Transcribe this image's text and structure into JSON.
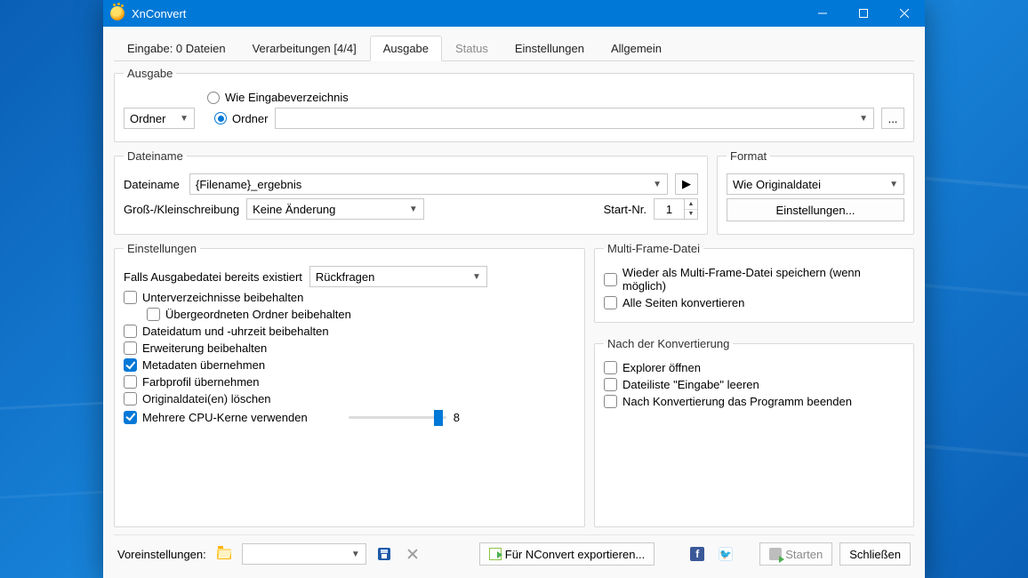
{
  "window": {
    "title": "XnConvert"
  },
  "tabs": [
    {
      "label": "Eingabe: 0 Dateien"
    },
    {
      "label": "Verarbeitungen [4/4]"
    },
    {
      "label": "Ausgabe",
      "active": true
    },
    {
      "label": "Status",
      "dim": true
    },
    {
      "label": "Einstellungen"
    },
    {
      "label": "Allgemein"
    }
  ],
  "output": {
    "legend": "Ausgabe",
    "target_select": "Ordner",
    "radio_same_as_input": "Wie Eingabeverzeichnis",
    "radio_folder": "Ordner",
    "folder_path": "",
    "browse": "..."
  },
  "filename": {
    "legend": "Dateiname",
    "label": "Dateiname",
    "value": "{Filename}_ergebnis",
    "play": "▶",
    "case_label": "Groß-/Kleinschreibung",
    "case_value": "Keine Änderung",
    "start_label": "Start-Nr.",
    "start_value": "1"
  },
  "format": {
    "legend": "Format",
    "value": "Wie Originaldatei",
    "settings_btn": "Einstellungen..."
  },
  "settings": {
    "legend": "Einstellungen",
    "exists_label": "Falls Ausgabedatei bereits existiert",
    "exists_value": "Rückfragen",
    "keep_subdirs": "Unterverzeichnisse beibehalten",
    "keep_parent": "Übergeordneten Ordner beibehalten",
    "keep_date": "Dateidatum und -uhrzeit beibehalten",
    "keep_ext": "Erweiterung beibehalten",
    "keep_meta": "Metadaten übernehmen",
    "keep_color": "Farbprofil übernehmen",
    "delete_orig": "Originaldatei(en) löschen",
    "multi_cpu": "Mehrere CPU-Kerne verwenden",
    "cpu_value": "8"
  },
  "multiframe": {
    "legend": "Multi-Frame-Datei",
    "resave": "Wieder als Multi-Frame-Datei speichern (wenn möglich)",
    "all_pages": "Alle Seiten konvertieren"
  },
  "after": {
    "legend": "Nach der Konvertierung",
    "open_explorer": "Explorer öffnen",
    "clear_input": "Dateiliste \"Eingabe\" leeren",
    "exit_app": "Nach Konvertierung das Programm beenden"
  },
  "footer": {
    "presets_label": "Voreinstellungen:",
    "preset_value": "",
    "export_btn": "Für NConvert exportieren...",
    "start_btn": "Starten",
    "close_btn": "Schließen"
  }
}
